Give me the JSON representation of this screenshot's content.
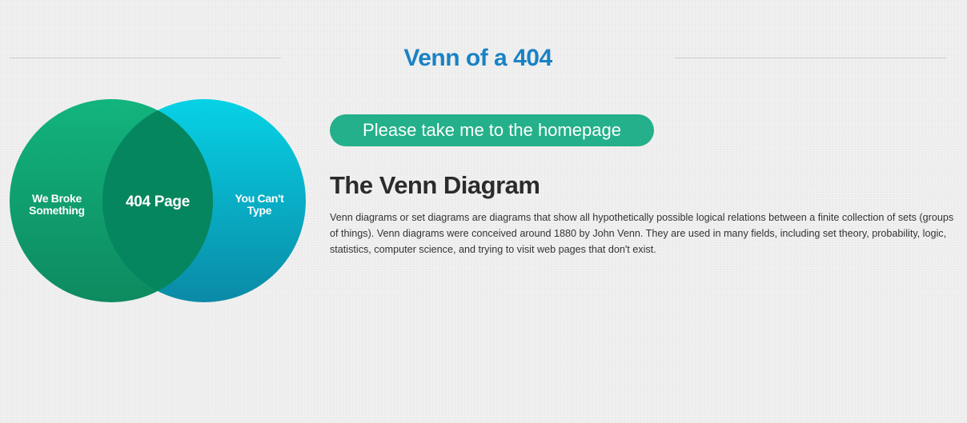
{
  "header": {
    "title": "Venn of a 404",
    "title_color": "#1a82c4"
  },
  "venn": {
    "left_label": "We Broke Something",
    "center_label": "404 Page",
    "right_label": "You Can't Type",
    "colors": {
      "left_circle_top": "#12b47e",
      "left_circle_bottom": "#0e8a5f",
      "right_circle_top": "#07d2e6",
      "right_circle_bottom": "#0a8aa6",
      "overlap": "#06865e"
    }
  },
  "cta": {
    "label": "Please take me to the homepage",
    "color": "#24b08a"
  },
  "article": {
    "heading": "The Venn Diagram",
    "body": "Venn diagrams or set diagrams are diagrams that show all hypothetically possible logical relations between a finite collection of sets (groups of things). Venn diagrams were conceived around 1880 by John Venn. They are used in many fields, including set theory, probability, logic, statistics, computer science, and trying to visit web pages that don't exist."
  }
}
